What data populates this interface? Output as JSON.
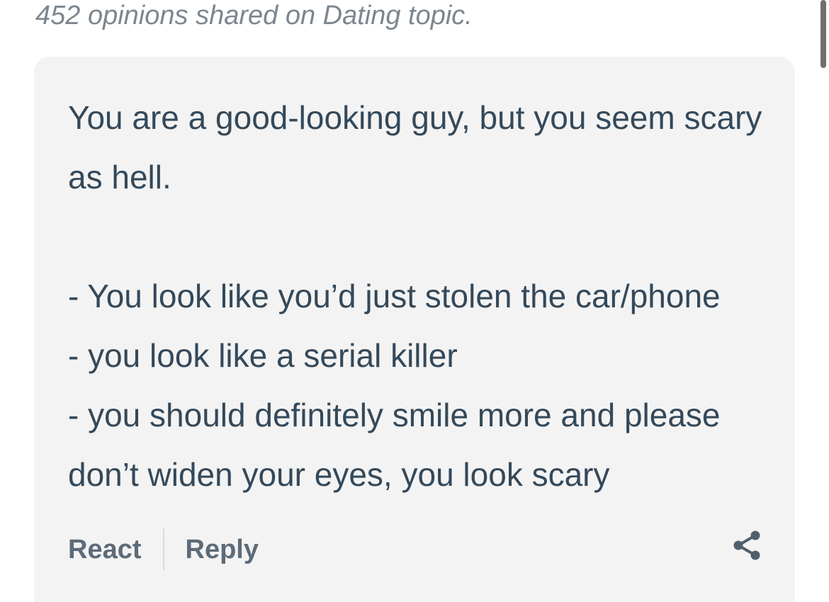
{
  "header": {
    "opinions_summary": "452 opinions shared on Dating topic."
  },
  "opinion": {
    "line1": "You are a good-looking guy, but you seem scary as hell.",
    "line2": "- You look like you’d just stolen the car/phone",
    "line3": "- you look like a serial killer",
    "line4": "- you should definitely smile more and please don’t widen your eyes, you look scary"
  },
  "actions": {
    "react_label": "React",
    "reply_label": "Reply",
    "share_icon": "share-icon"
  },
  "colors": {
    "card_background": "#f3f3f3",
    "body_text": "#34495a",
    "meta_text": "#7d868f",
    "action_text": "#5d6b78"
  }
}
